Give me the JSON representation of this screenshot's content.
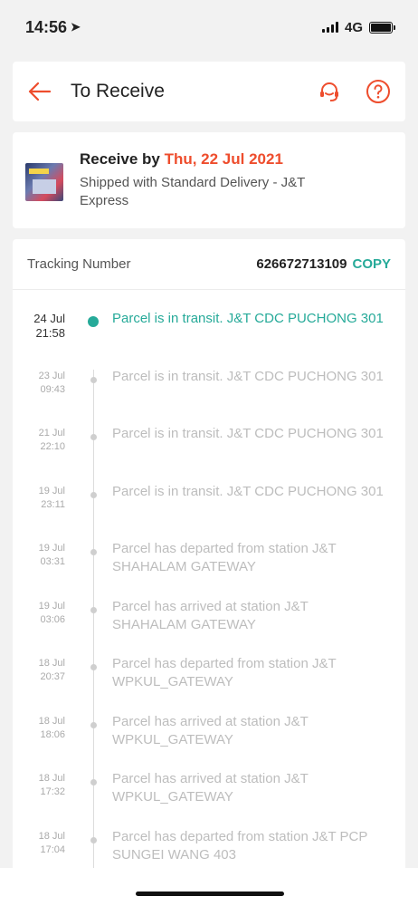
{
  "status_bar": {
    "time": "14:56",
    "network": "4G"
  },
  "header": {
    "title": "To Receive",
    "back_icon": "back-arrow-icon",
    "support_icon": "headset-icon",
    "help_icon": "help-circle-icon"
  },
  "receive": {
    "label": "Receive by",
    "date": "Thu, 22 Jul 2021",
    "shipping": "Shipped with Standard Delivery  - J&T Express"
  },
  "tracking": {
    "label": "Tracking Number",
    "number": "626672713109",
    "copy_label": "COPY"
  },
  "events": [
    {
      "date": "24 Jul",
      "time": "21:58",
      "text": "Parcel is in transit. J&T CDC PUCHONG 301"
    },
    {
      "date": "23 Jul",
      "time": "09:43",
      "text": "Parcel is in transit. J&T CDC PUCHONG 301"
    },
    {
      "date": "21 Jul",
      "time": "22:10",
      "text": "Parcel is in transit. J&T CDC PUCHONG 301"
    },
    {
      "date": "19 Jul",
      "time": "23:11",
      "text": "Parcel is in transit. J&T CDC PUCHONG 301"
    },
    {
      "date": "19 Jul",
      "time": "03:31",
      "text": "Parcel has departed from station J&T SHAHALAM GATEWAY"
    },
    {
      "date": "19 Jul",
      "time": "03:06",
      "text": "Parcel has arrived at station J&T SHAHALAM GATEWAY"
    },
    {
      "date": "18 Jul",
      "time": "20:37",
      "text": "Parcel has departed from station J&T WPKUL_GATEWAY"
    },
    {
      "date": "18 Jul",
      "time": "18:06",
      "text": "Parcel has arrived at station J&T WPKUL_GATEWAY"
    },
    {
      "date": "18 Jul",
      "time": "17:32",
      "text": "Parcel has arrived at station J&T WPKUL_GATEWAY"
    },
    {
      "date": "18 Jul",
      "time": "17:04",
      "text": "Parcel has departed from station J&T PCP SUNGEI WANG 403"
    }
  ],
  "colors": {
    "accent": "#ee4d2d",
    "teal": "#26aa99"
  }
}
